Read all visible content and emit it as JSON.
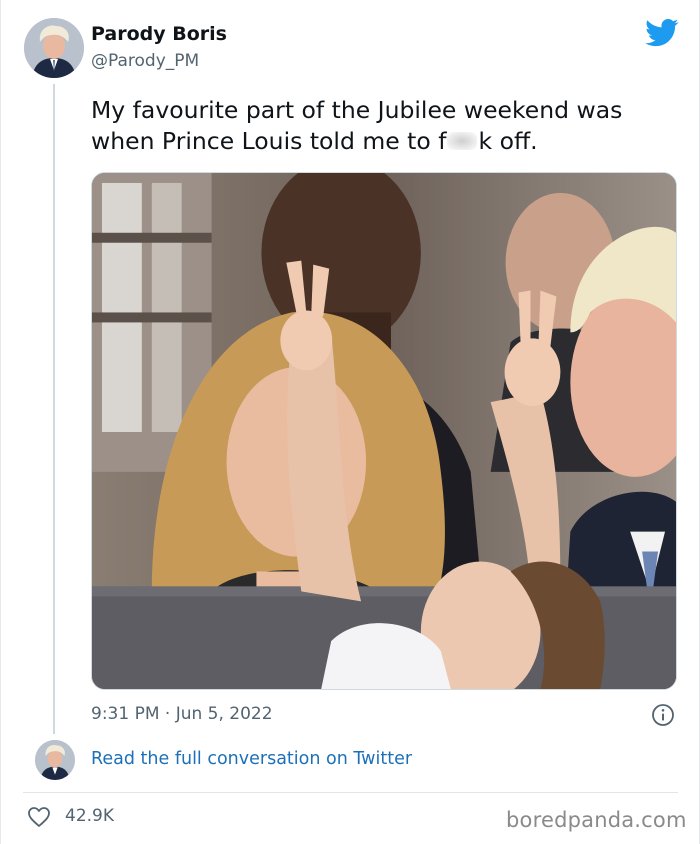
{
  "author": {
    "display_name": "Parody Boris",
    "handle": "@Parody_PM"
  },
  "tweet": {
    "text_before": "My favourite part of the Jubilee weekend was when Prince Louis told me to f",
    "text_after": "k off.",
    "timestamp": "9:31 PM · Jun 5, 2022"
  },
  "actions": {
    "read_conversation": "Read the full conversation on Twitter"
  },
  "stats": {
    "likes": "42.9K"
  },
  "watermark": "boredpanda.com",
  "icons": {
    "brand": "twitter-bird-icon",
    "info": "info-icon",
    "like": "heart-icon"
  },
  "colors": {
    "twitter_blue": "#1d9bf0",
    "link": "#1d70b8",
    "secondary_text": "#536471"
  }
}
